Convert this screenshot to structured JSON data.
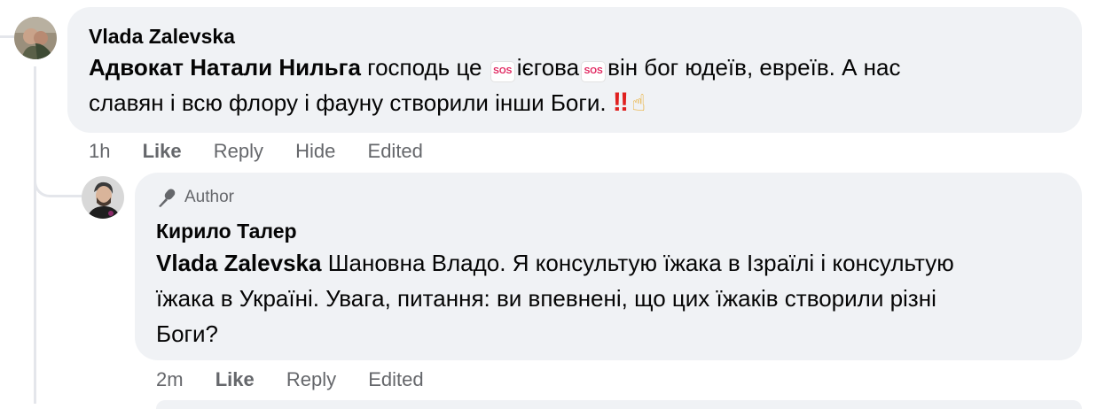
{
  "comment": {
    "author": "Vlada Zalevska",
    "mention": "Адвокат Натали Нильга",
    "text_part1": " господь це ",
    "sos_1": "SOS",
    "text_part2": "ієгова",
    "sos_2": "SOS",
    "text_part3": "він бог юдеїв, евреїв. А нас",
    "text_line2": "славян і всю флору і фауну створили інши Боги. ",
    "emoji_bang": "‼",
    "emoji_hand": "☝",
    "time": "1h",
    "like_label": "Like",
    "reply_label": "Reply",
    "hide_label": "Hide",
    "edited_label": "Edited"
  },
  "reply": {
    "badge_label": "Author",
    "author": "Кирило Талер",
    "mention": "Vlada Zalevska",
    "line1": " Шановна Владо. Я консультую їжака в Ізраїлі і консультую",
    "line2": "їжака в Україні. Увага, питання: ви впевнені, що цих їжаків створили різні",
    "line3": "Боги?",
    "time": "2m",
    "like_label": "Like",
    "reply_label": "Reply",
    "edited_label": "Edited"
  },
  "colors": {
    "bubble": "#f0f2f5",
    "meta_text": "#65676b",
    "thread_line": "#e4e6eb"
  }
}
